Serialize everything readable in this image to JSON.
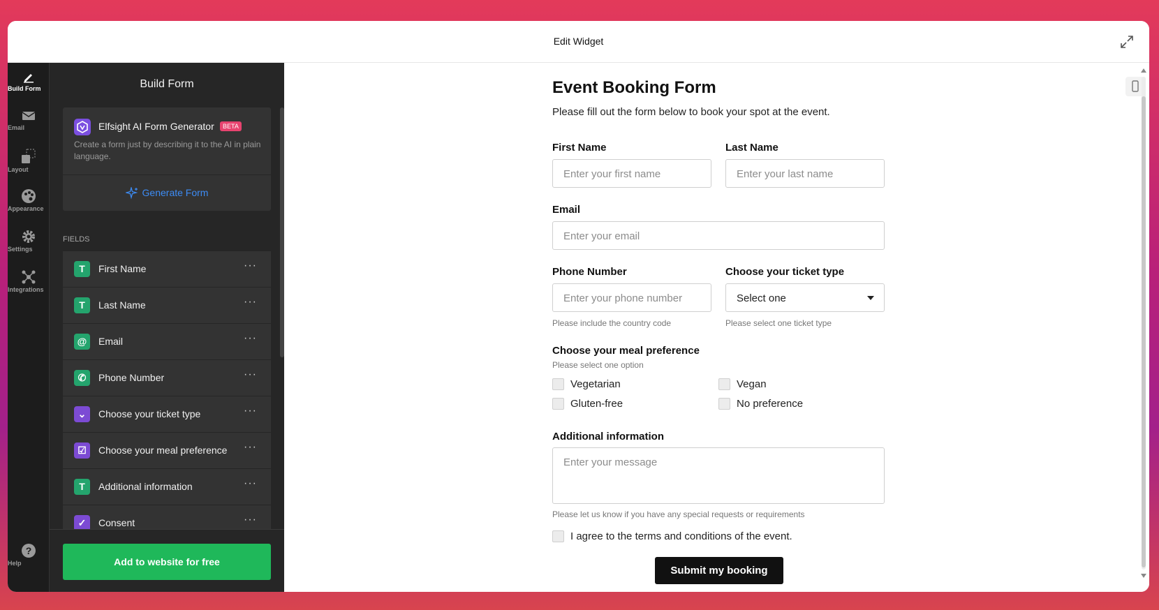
{
  "window": {
    "title": "Edit Widget"
  },
  "rail": {
    "items": [
      {
        "label": "Build Form",
        "icon": "pencil-icon"
      },
      {
        "label": "Email",
        "icon": "envelope-icon"
      },
      {
        "label": "Layout",
        "icon": "layout-icon"
      },
      {
        "label": "Appearance",
        "icon": "palette-icon"
      },
      {
        "label": "Settings",
        "icon": "gear-icon"
      },
      {
        "label": "Integrations",
        "icon": "integrations-icon"
      }
    ],
    "help": {
      "label": "Help",
      "icon": "question-icon"
    }
  },
  "panel": {
    "title": "Build Form",
    "ai": {
      "name": "Elfsight AI Form Generator",
      "badge": "BETA",
      "description": "Create a form just by describing it to the AI in plain language.",
      "generate_label": "Generate Form"
    },
    "fields_label": "FIELDS",
    "fields": [
      {
        "name": "First Name",
        "icon_text": "T",
        "color": "#24a46d"
      },
      {
        "name": "Last Name",
        "icon_text": "T",
        "color": "#24a46d"
      },
      {
        "name": "Email",
        "icon_text": "@",
        "color": "#24a46d"
      },
      {
        "name": "Phone Number",
        "icon_text": "✆",
        "color": "#24a46d"
      },
      {
        "name": "Choose your ticket type",
        "icon_text": "⌄",
        "color": "#7c4bd4"
      },
      {
        "name": "Choose your meal preference",
        "icon_text": "☑",
        "color": "#7c4bd4"
      },
      {
        "name": "Additional information",
        "icon_text": "T",
        "color": "#24a46d"
      },
      {
        "name": "Consent",
        "icon_text": "✓",
        "color": "#7c4bd4"
      }
    ],
    "more_label": "···",
    "add_button": "Add to website for free"
  },
  "form": {
    "title": "Event Booking Form",
    "subtitle": "Please fill out the form below to book your spot at the event.",
    "first_name": {
      "label": "First Name",
      "placeholder": "Enter your first name"
    },
    "last_name": {
      "label": "Last Name",
      "placeholder": "Enter your last name"
    },
    "email": {
      "label": "Email",
      "placeholder": "Enter your email"
    },
    "phone": {
      "label": "Phone Number",
      "placeholder": "Enter your phone number",
      "help": "Please include the country code"
    },
    "ticket": {
      "label": "Choose your ticket type",
      "value": "Select one",
      "help": "Please select one ticket type"
    },
    "meal": {
      "label": "Choose your meal preference",
      "help": "Please select one option",
      "options": [
        "Vegetarian",
        "Vegan",
        "Gluten-free",
        "No preference"
      ]
    },
    "additional": {
      "label": "Additional information",
      "placeholder": "Enter your message",
      "help": "Please let us know if you have any special requests or requirements"
    },
    "consent": "I agree to the terms and conditions of the event.",
    "submit": "Submit my booking"
  },
  "colors": {
    "accent": "#3d8cf5",
    "cta": "#1fb85a",
    "beta": "#e8436f"
  }
}
